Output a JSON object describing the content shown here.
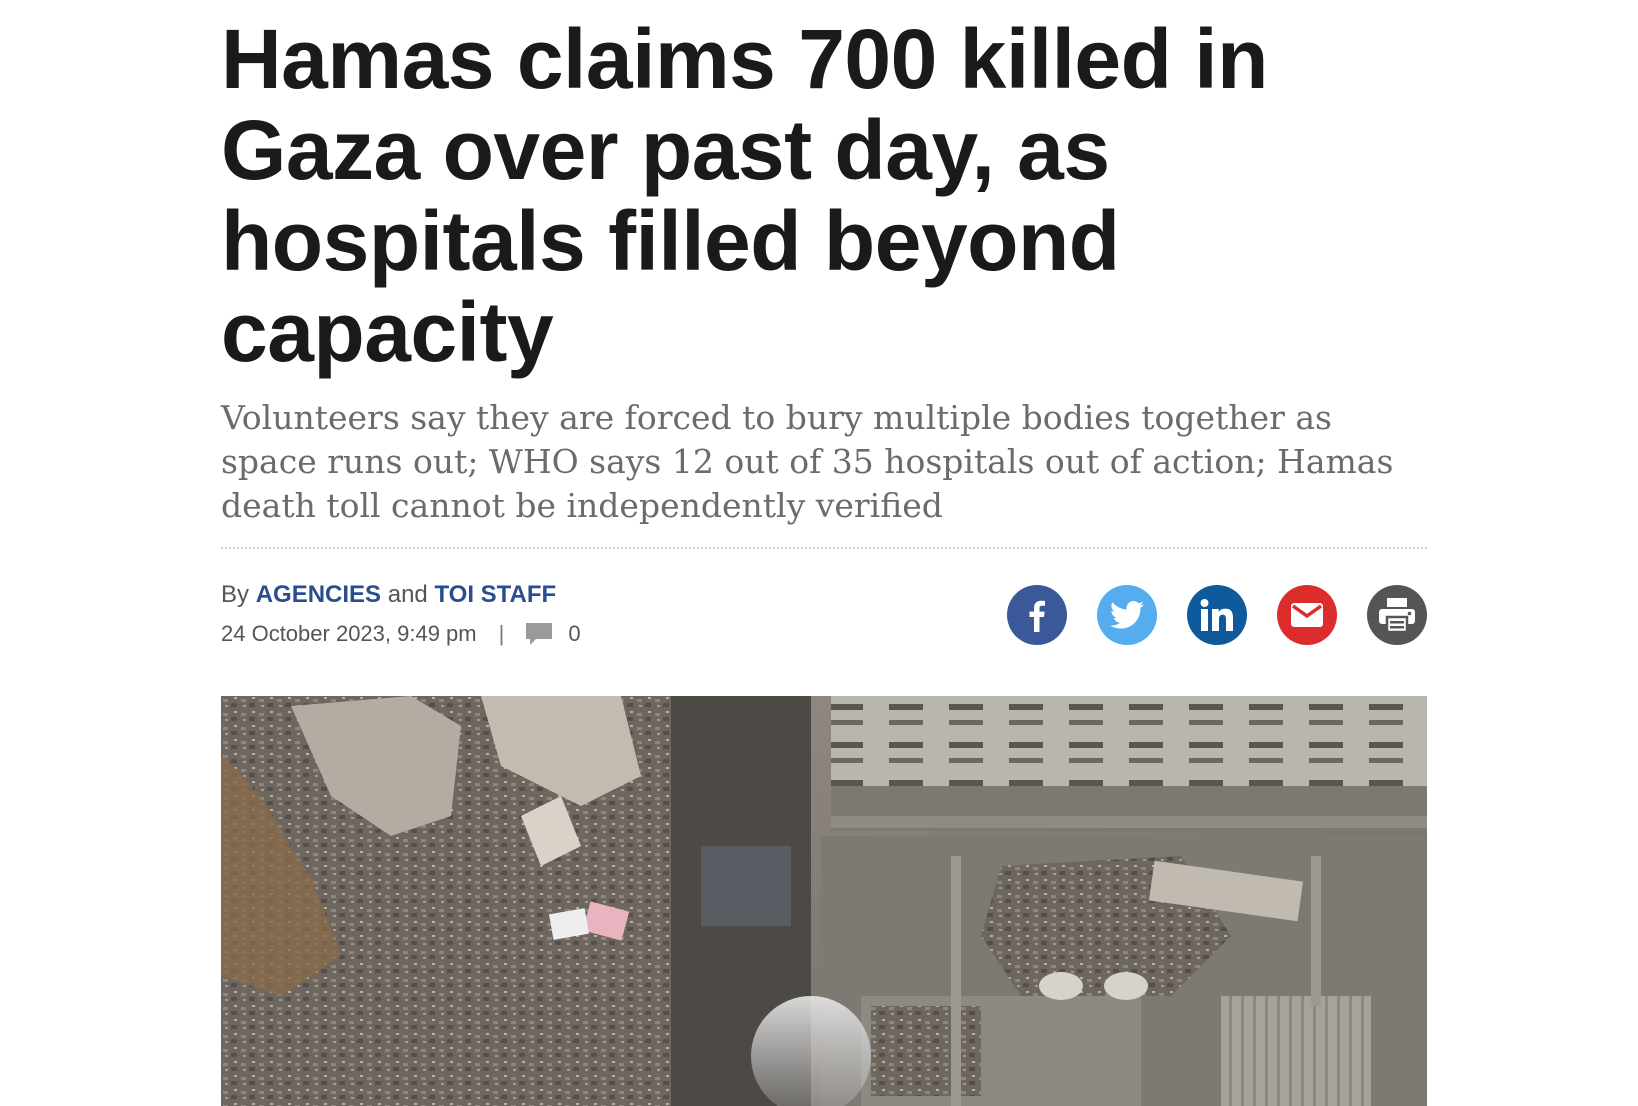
{
  "article": {
    "headline": "Hamas claims 700 killed in Gaza over past day, as hospitals filled beyond capacity",
    "subhead": "Volunteers say they are forced to bury multiple bodies together as space runs out; WHO says 12 out of 35 hospitals out of action; Hamas death toll cannot be independently verified",
    "byline": {
      "prefix": "By",
      "author_1": "AGENCIES",
      "joiner": "and",
      "author_2": "TOI STAFF"
    },
    "date": "24 October 2023, 9:49 pm",
    "separator": "|",
    "comment_count": "0"
  },
  "share": {
    "icons": [
      "facebook-icon",
      "twitter-icon",
      "linkedin-icon",
      "email-icon",
      "print-icon"
    ],
    "colors": {
      "facebook": "#3b5998",
      "twitter": "#55acee",
      "linkedin": "#0e5a9c",
      "email": "#dd2c2c",
      "print": "#555555"
    }
  },
  "colors": {
    "headline": "#1a1a1a",
    "subhead": "#6b6b6b",
    "author_link": "#2a4d8f",
    "meta": "#555555"
  }
}
